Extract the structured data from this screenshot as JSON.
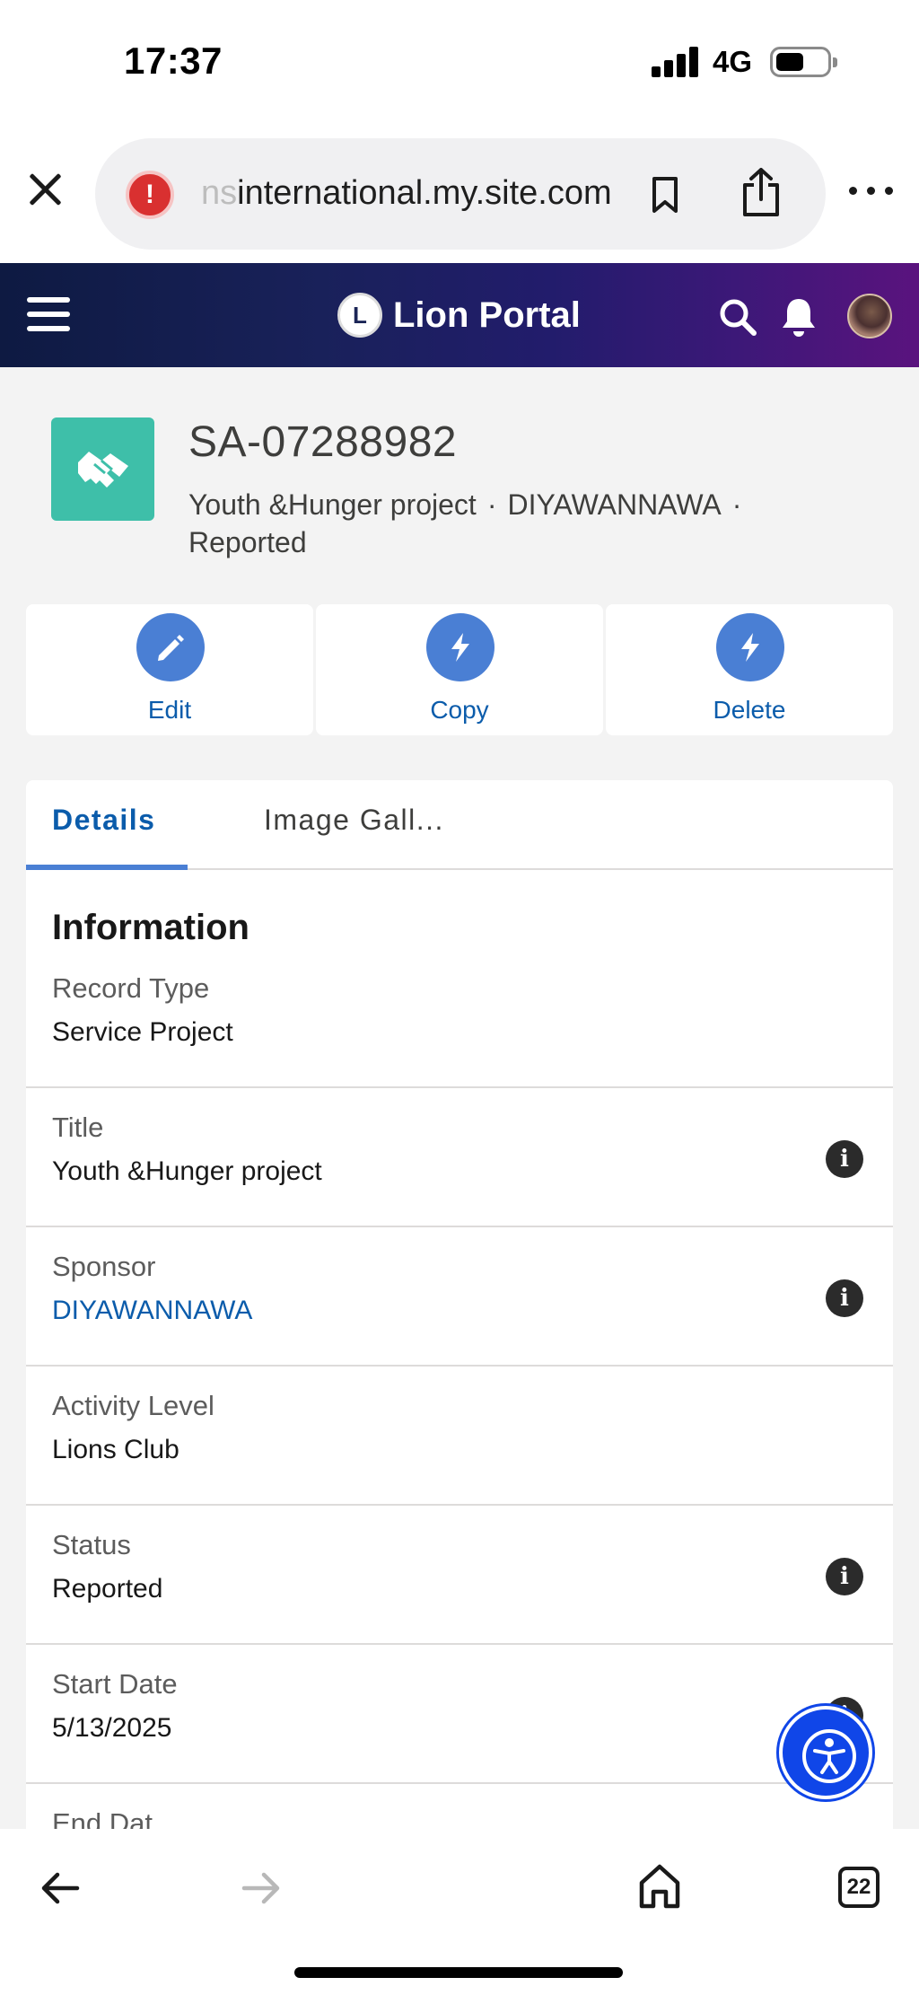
{
  "status_bar": {
    "time": "17:37",
    "network": "4G"
  },
  "browser": {
    "url_faded": "ns",
    "url_main": "international.my.site.com"
  },
  "portal": {
    "logo_text": "L",
    "title": "Lion Portal"
  },
  "record": {
    "id": "SA-07288982",
    "subtitle_title": "Youth &Hunger project",
    "subtitle_sponsor": "DIYAWANNAWA",
    "subtitle_status": "Reported",
    "separator": "·"
  },
  "actions": [
    {
      "label": "Edit",
      "icon": "pencil-icon"
    },
    {
      "label": "Copy",
      "icon": "lightning-icon"
    },
    {
      "label": "Delete",
      "icon": "lightning-icon"
    }
  ],
  "tabs": [
    {
      "label": "Details",
      "active": true
    },
    {
      "label": "Image Gall...",
      "active": false
    }
  ],
  "section": {
    "title": "Information"
  },
  "fields": [
    {
      "label": "Record Type",
      "value": "Service Project",
      "info": false,
      "link": false
    },
    {
      "label": "Title",
      "value": "Youth &Hunger project",
      "info": true,
      "link": false
    },
    {
      "label": "Sponsor",
      "value": "DIYAWANNAWA",
      "info": true,
      "link": true
    },
    {
      "label": "Activity Level",
      "value": "Lions Club",
      "info": false,
      "link": false
    },
    {
      "label": "Status",
      "value": "Reported",
      "info": true,
      "link": false
    },
    {
      "label": "Start Date",
      "value": "5/13/2025",
      "info": true,
      "link": false
    },
    {
      "label": "End Date",
      "value": "",
      "info": false,
      "link": false
    }
  ],
  "bottom_nav": {
    "tab_count": "22"
  },
  "colors": {
    "header_start": "#0e1a42",
    "header_end": "#5a137e",
    "record_icon": "#3ebfa9",
    "action_circle": "#4a7fd4",
    "link": "#0b5cab",
    "accessibility": "#1046e8"
  }
}
